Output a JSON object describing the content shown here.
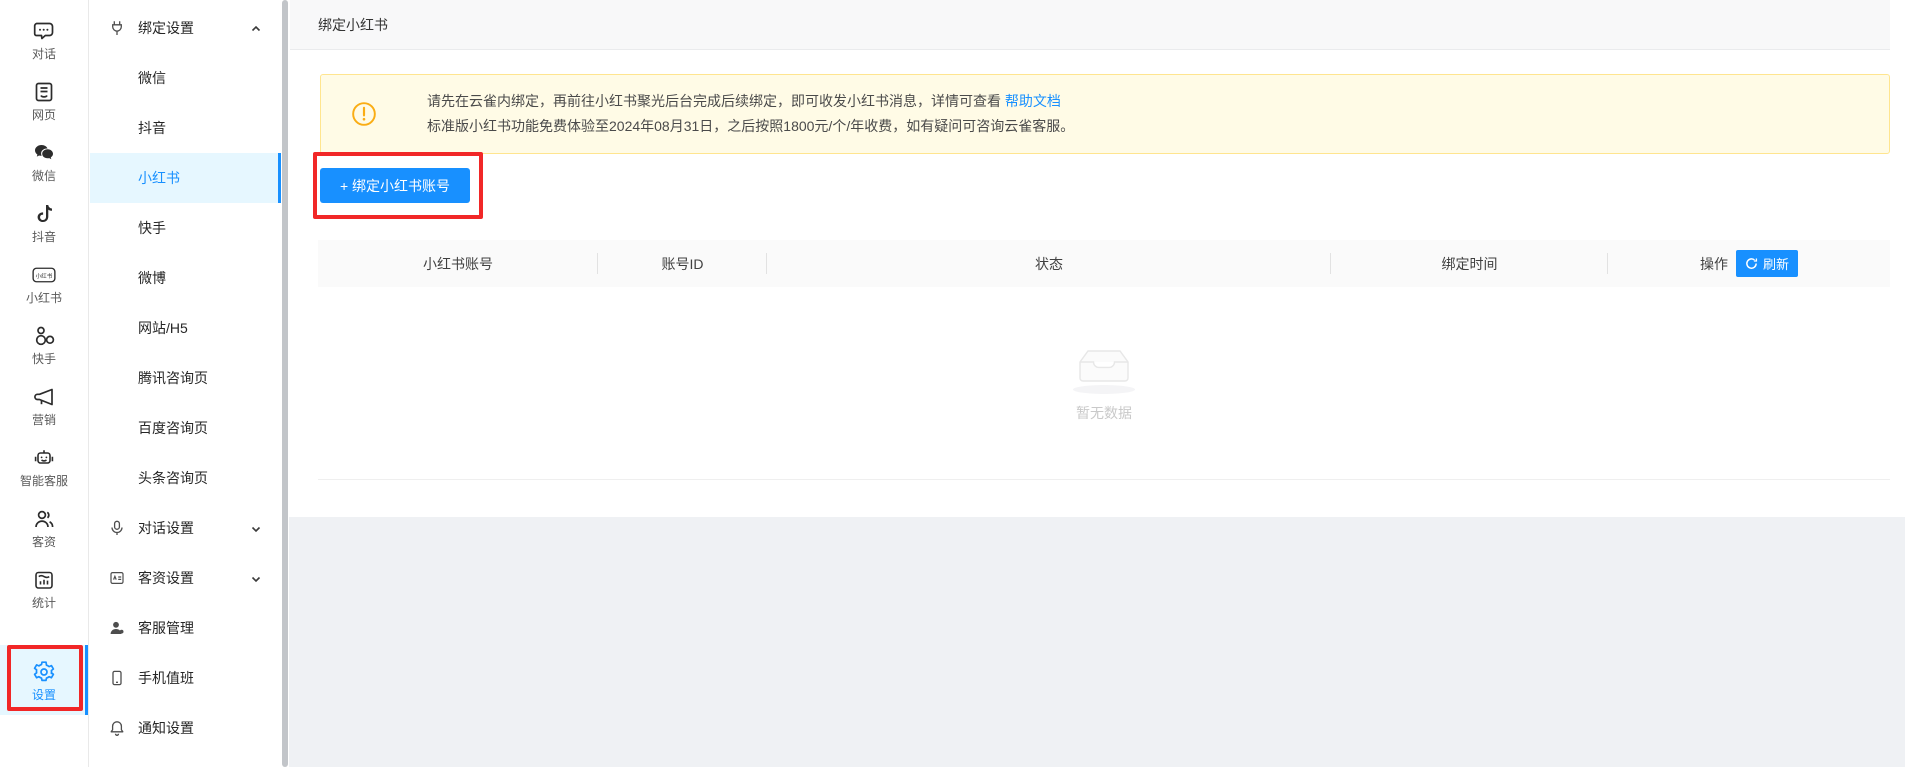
{
  "app": {
    "page_title": "绑定小红书"
  },
  "primary_sidebar": {
    "items": [
      {
        "label": "对话",
        "icon": "chat-icon"
      },
      {
        "label": "网页",
        "icon": "webpage-icon"
      },
      {
        "label": "微信",
        "icon": "wechat-icon"
      },
      {
        "label": "抖音",
        "icon": "douyin-icon"
      },
      {
        "label": "小红书",
        "icon": "xiaohongshu-icon"
      },
      {
        "label": "快手",
        "icon": "kuaishou-icon"
      },
      {
        "label": "营销",
        "icon": "megaphone-icon"
      },
      {
        "label": "智能客服",
        "icon": "robot-icon"
      },
      {
        "label": "客资",
        "icon": "people-icon"
      },
      {
        "label": "统计",
        "icon": "stats-icon"
      },
      {
        "label": "设置",
        "icon": "gear-icon",
        "active": true
      }
    ]
  },
  "secondary_sidebar": {
    "groups": [
      {
        "label": "绑定设置",
        "icon": "plug-icon",
        "state": "expanded",
        "children": [
          "微信",
          "抖音",
          "小红书",
          "快手",
          "微博",
          "网站/H5",
          "腾讯咨询页",
          "百度咨询页",
          "头条咨询页"
        ],
        "active_child": "小红书"
      },
      {
        "label": "对话设置",
        "icon": "microphone-icon",
        "state": "collapsed"
      },
      {
        "label": "客资设置",
        "icon": "idcard-icon",
        "state": "collapsed"
      },
      {
        "label": "客服管理",
        "icon": "person-icon"
      },
      {
        "label": "手机值班",
        "icon": "phone-icon"
      },
      {
        "label": "通知设置",
        "icon": "bell-icon"
      }
    ]
  },
  "banner": {
    "line1": "请先在云雀内绑定，再前往小红书聚光后台完成后续绑定，即可收发小红书消息，详情可查看",
    "link": "帮助文档",
    "line2": "标准版小红书功能免费体验至2024年08月31日，之后按照1800元/个/年收费，如有疑问可咨询云雀客服。"
  },
  "actions": {
    "bind_button": "+ 绑定小红书账号",
    "refresh_button": "刷新"
  },
  "table": {
    "columns": [
      "小红书账号",
      "账号ID",
      "状态",
      "绑定时间",
      "操作"
    ],
    "rows": [],
    "empty_text": "暂无数据"
  },
  "colors": {
    "accent_blue": "#1890ff",
    "selected_bg": "#e6f7ff",
    "banner_bg": "#fffbe6",
    "banner_border": "#ffe58f",
    "warning_orange": "#faad14",
    "annotation_red": "#f12727",
    "page_gray": "#eff1f4"
  }
}
